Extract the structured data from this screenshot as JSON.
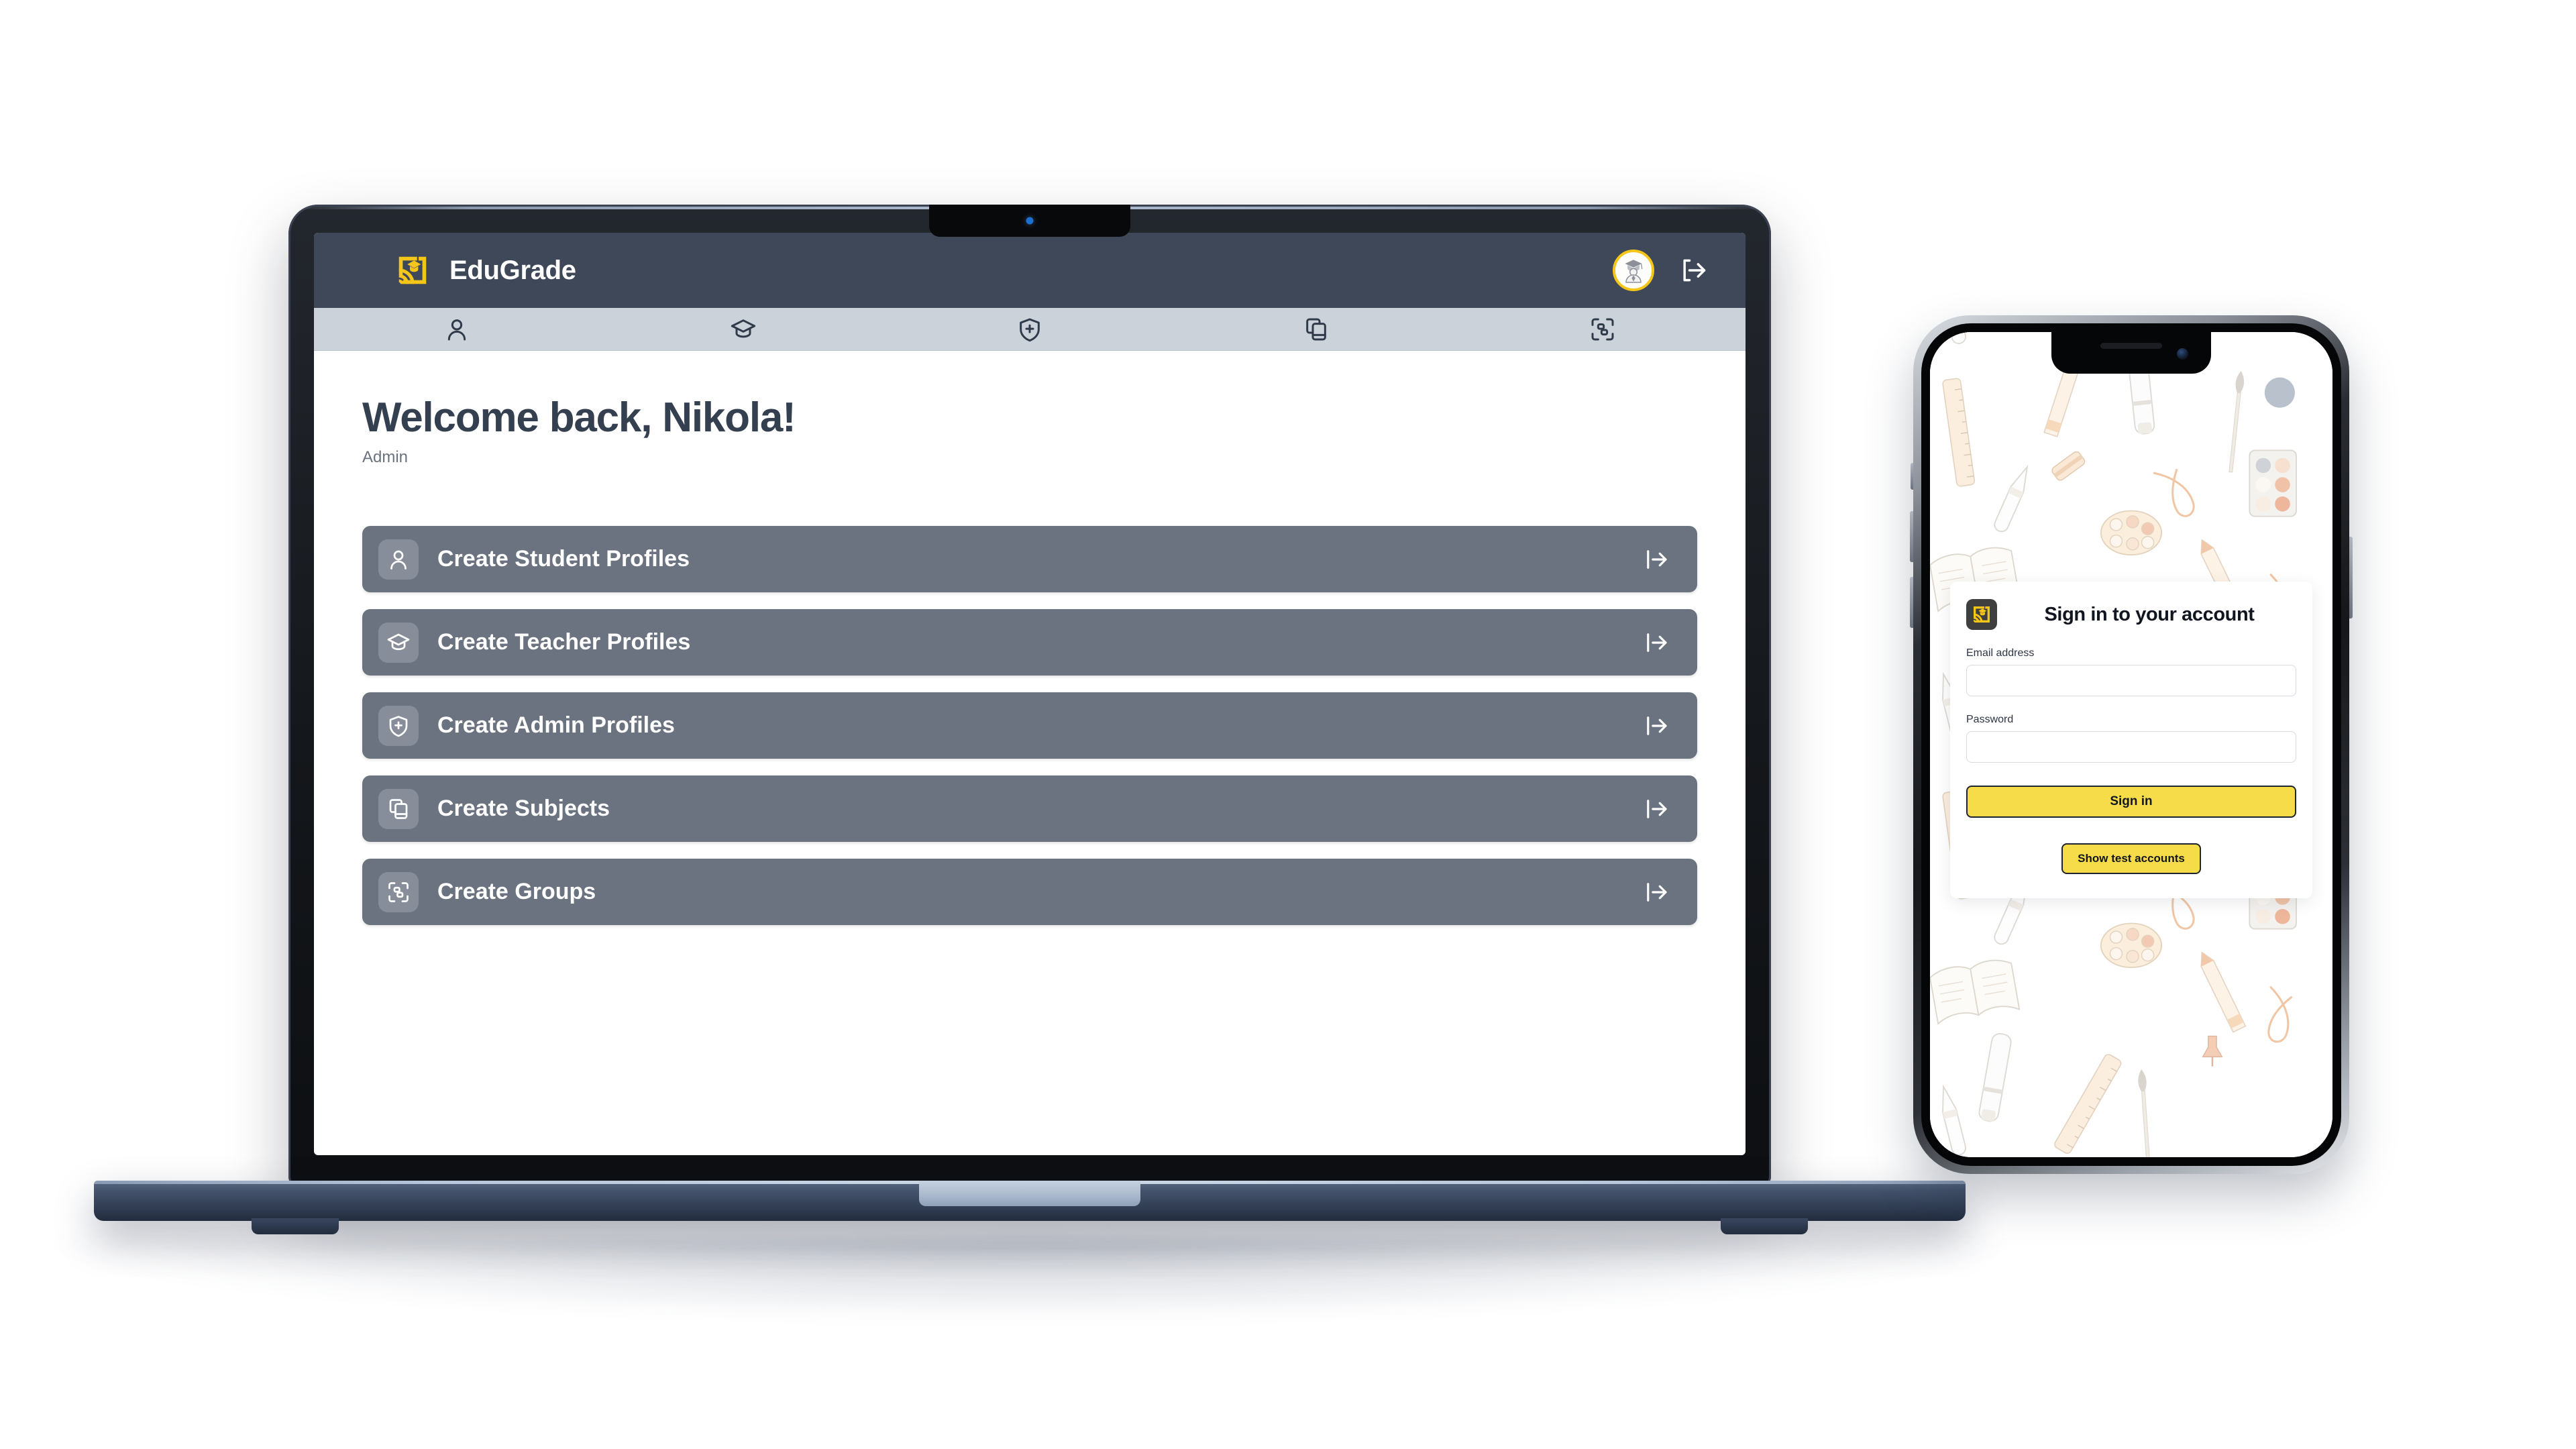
{
  "brand": {
    "name": "EduGrade",
    "logo_icon": "edugrade-cast-cap-logo",
    "accent_color": "#f5c518",
    "header_color": "#3e4859"
  },
  "desktop": {
    "header": {
      "avatar_icon": "graduate-avatar-icon",
      "logout_icon": "logout-icon"
    },
    "nav": {
      "items": [
        {
          "icon": "user-icon",
          "name": "nav-students"
        },
        {
          "icon": "graduation-cap-icon",
          "name": "nav-teachers"
        },
        {
          "icon": "shield-plus-icon",
          "name": "nav-admins"
        },
        {
          "icon": "copy-icon",
          "name": "nav-subjects"
        },
        {
          "icon": "scan-group-icon",
          "name": "nav-groups"
        }
      ]
    },
    "main": {
      "title": "Welcome back, Nikola!",
      "subtitle": "Admin",
      "card_color": "#6b7280",
      "cards": [
        {
          "label": "Create Student Profiles",
          "icon": "user-icon",
          "go_icon": "arrow-right-from-line-icon"
        },
        {
          "label": "Create Teacher Profiles",
          "icon": "graduation-cap-icon",
          "go_icon": "arrow-right-from-line-icon"
        },
        {
          "label": "Create Admin Profiles",
          "icon": "shield-plus-icon",
          "go_icon": "arrow-right-from-line-icon"
        },
        {
          "label": "Create Subjects",
          "icon": "copy-icon",
          "go_icon": "arrow-right-from-line-icon"
        },
        {
          "label": "Create Groups",
          "icon": "scan-group-icon",
          "go_icon": "arrow-right-from-line-icon"
        }
      ]
    }
  },
  "phone": {
    "login": {
      "logo_icon": "edugrade-cast-cap-logo",
      "title": "Sign in to your account",
      "email_label": "Email address",
      "email_value": "",
      "email_placeholder": "",
      "password_label": "Password",
      "password_value": "",
      "password_placeholder": "",
      "signin_label": "Sign in",
      "test_accounts_label": "Show test accounts",
      "button_color": "#f7dc4a"
    }
  }
}
